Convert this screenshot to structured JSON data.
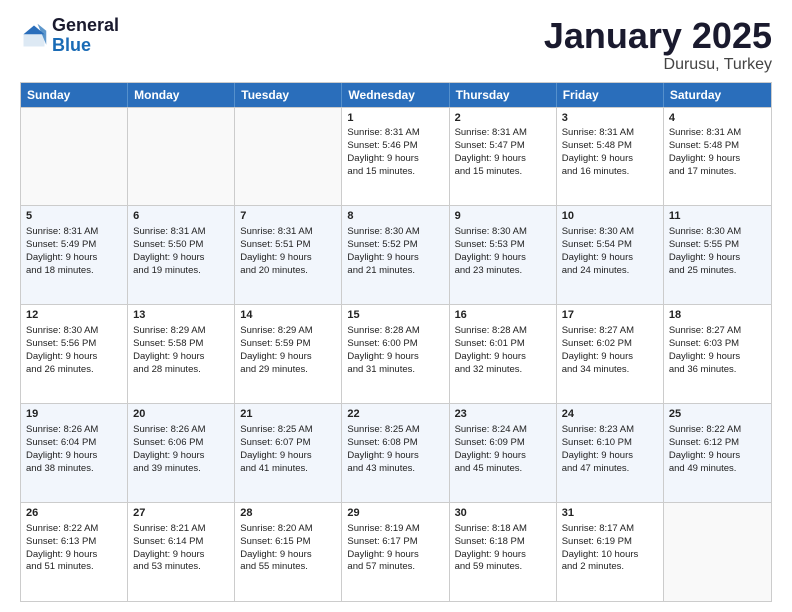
{
  "logo": {
    "general": "General",
    "blue": "Blue"
  },
  "title": "January 2025",
  "subtitle": "Durusu, Turkey",
  "days": [
    "Sunday",
    "Monday",
    "Tuesday",
    "Wednesday",
    "Thursday",
    "Friday",
    "Saturday"
  ],
  "weeks": [
    [
      {
        "day": "",
        "info": ""
      },
      {
        "day": "",
        "info": ""
      },
      {
        "day": "",
        "info": ""
      },
      {
        "day": "1",
        "info": "Sunrise: 8:31 AM\nSunset: 5:46 PM\nDaylight: 9 hours\nand 15 minutes."
      },
      {
        "day": "2",
        "info": "Sunrise: 8:31 AM\nSunset: 5:47 PM\nDaylight: 9 hours\nand 15 minutes."
      },
      {
        "day": "3",
        "info": "Sunrise: 8:31 AM\nSunset: 5:48 PM\nDaylight: 9 hours\nand 16 minutes."
      },
      {
        "day": "4",
        "info": "Sunrise: 8:31 AM\nSunset: 5:48 PM\nDaylight: 9 hours\nand 17 minutes."
      }
    ],
    [
      {
        "day": "5",
        "info": "Sunrise: 8:31 AM\nSunset: 5:49 PM\nDaylight: 9 hours\nand 18 minutes."
      },
      {
        "day": "6",
        "info": "Sunrise: 8:31 AM\nSunset: 5:50 PM\nDaylight: 9 hours\nand 19 minutes."
      },
      {
        "day": "7",
        "info": "Sunrise: 8:31 AM\nSunset: 5:51 PM\nDaylight: 9 hours\nand 20 minutes."
      },
      {
        "day": "8",
        "info": "Sunrise: 8:30 AM\nSunset: 5:52 PM\nDaylight: 9 hours\nand 21 minutes."
      },
      {
        "day": "9",
        "info": "Sunrise: 8:30 AM\nSunset: 5:53 PM\nDaylight: 9 hours\nand 23 minutes."
      },
      {
        "day": "10",
        "info": "Sunrise: 8:30 AM\nSunset: 5:54 PM\nDaylight: 9 hours\nand 24 minutes."
      },
      {
        "day": "11",
        "info": "Sunrise: 8:30 AM\nSunset: 5:55 PM\nDaylight: 9 hours\nand 25 minutes."
      }
    ],
    [
      {
        "day": "12",
        "info": "Sunrise: 8:30 AM\nSunset: 5:56 PM\nDaylight: 9 hours\nand 26 minutes."
      },
      {
        "day": "13",
        "info": "Sunrise: 8:29 AM\nSunset: 5:58 PM\nDaylight: 9 hours\nand 28 minutes."
      },
      {
        "day": "14",
        "info": "Sunrise: 8:29 AM\nSunset: 5:59 PM\nDaylight: 9 hours\nand 29 minutes."
      },
      {
        "day": "15",
        "info": "Sunrise: 8:28 AM\nSunset: 6:00 PM\nDaylight: 9 hours\nand 31 minutes."
      },
      {
        "day": "16",
        "info": "Sunrise: 8:28 AM\nSunset: 6:01 PM\nDaylight: 9 hours\nand 32 minutes."
      },
      {
        "day": "17",
        "info": "Sunrise: 8:27 AM\nSunset: 6:02 PM\nDaylight: 9 hours\nand 34 minutes."
      },
      {
        "day": "18",
        "info": "Sunrise: 8:27 AM\nSunset: 6:03 PM\nDaylight: 9 hours\nand 36 minutes."
      }
    ],
    [
      {
        "day": "19",
        "info": "Sunrise: 8:26 AM\nSunset: 6:04 PM\nDaylight: 9 hours\nand 38 minutes."
      },
      {
        "day": "20",
        "info": "Sunrise: 8:26 AM\nSunset: 6:06 PM\nDaylight: 9 hours\nand 39 minutes."
      },
      {
        "day": "21",
        "info": "Sunrise: 8:25 AM\nSunset: 6:07 PM\nDaylight: 9 hours\nand 41 minutes."
      },
      {
        "day": "22",
        "info": "Sunrise: 8:25 AM\nSunset: 6:08 PM\nDaylight: 9 hours\nand 43 minutes."
      },
      {
        "day": "23",
        "info": "Sunrise: 8:24 AM\nSunset: 6:09 PM\nDaylight: 9 hours\nand 45 minutes."
      },
      {
        "day": "24",
        "info": "Sunrise: 8:23 AM\nSunset: 6:10 PM\nDaylight: 9 hours\nand 47 minutes."
      },
      {
        "day": "25",
        "info": "Sunrise: 8:22 AM\nSunset: 6:12 PM\nDaylight: 9 hours\nand 49 minutes."
      }
    ],
    [
      {
        "day": "26",
        "info": "Sunrise: 8:22 AM\nSunset: 6:13 PM\nDaylight: 9 hours\nand 51 minutes."
      },
      {
        "day": "27",
        "info": "Sunrise: 8:21 AM\nSunset: 6:14 PM\nDaylight: 9 hours\nand 53 minutes."
      },
      {
        "day": "28",
        "info": "Sunrise: 8:20 AM\nSunset: 6:15 PM\nDaylight: 9 hours\nand 55 minutes."
      },
      {
        "day": "29",
        "info": "Sunrise: 8:19 AM\nSunset: 6:17 PM\nDaylight: 9 hours\nand 57 minutes."
      },
      {
        "day": "30",
        "info": "Sunrise: 8:18 AM\nSunset: 6:18 PM\nDaylight: 9 hours\nand 59 minutes."
      },
      {
        "day": "31",
        "info": "Sunrise: 8:17 AM\nSunset: 6:19 PM\nDaylight: 10 hours\nand 2 minutes."
      },
      {
        "day": "",
        "info": ""
      }
    ]
  ]
}
